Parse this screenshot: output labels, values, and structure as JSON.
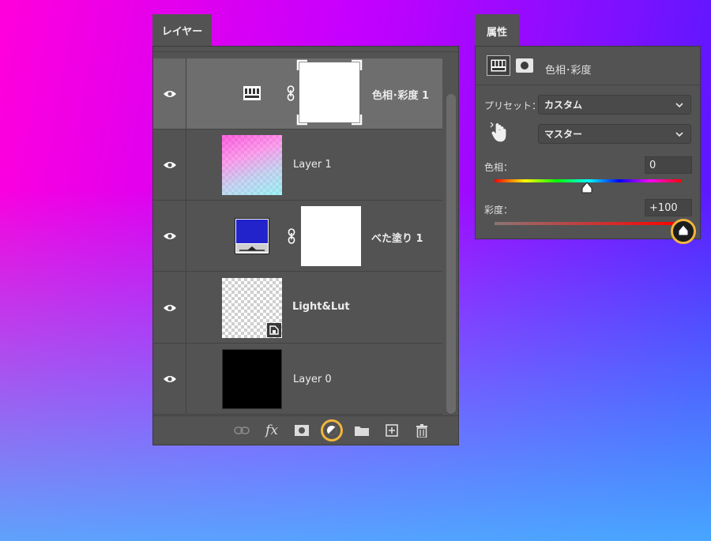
{
  "layers_panel": {
    "tab_label": "レイヤー",
    "layers": [
      {
        "name": "色相･彩度 1",
        "visible": true,
        "selected": true,
        "kind": "adjustment"
      },
      {
        "name": "Layer 1",
        "visible": true,
        "selected": false,
        "kind": "gradient"
      },
      {
        "name": "べた塗り 1",
        "visible": true,
        "selected": false,
        "kind": "fill"
      },
      {
        "name": "Light&Lut",
        "visible": true,
        "selected": false,
        "kind": "smart-object"
      },
      {
        "name": "Layer 0",
        "visible": true,
        "selected": false,
        "kind": "black"
      }
    ],
    "footer_icons": [
      "link-icon",
      "fx-icon",
      "mask-icon",
      "adjustment-icon",
      "folder-icon",
      "new-layer-icon",
      "trash-icon"
    ],
    "fx_label": "fx",
    "highlighted_footer_icon": "adjustment-icon"
  },
  "properties_panel": {
    "tab_label": "属性",
    "header_title": "色相･彩度",
    "preset_label": "プリセット：",
    "preset_value": "カスタム",
    "channel_value": "マスター",
    "hue_label": "色相：",
    "hue_value": "0",
    "saturation_label": "彩度：",
    "saturation_value": "+100"
  },
  "colors": {
    "panel_bg": "#535353",
    "selected_row": "#6a6a6a",
    "highlight_ring": "#f2b53c",
    "fill_color": "#2323cc"
  }
}
